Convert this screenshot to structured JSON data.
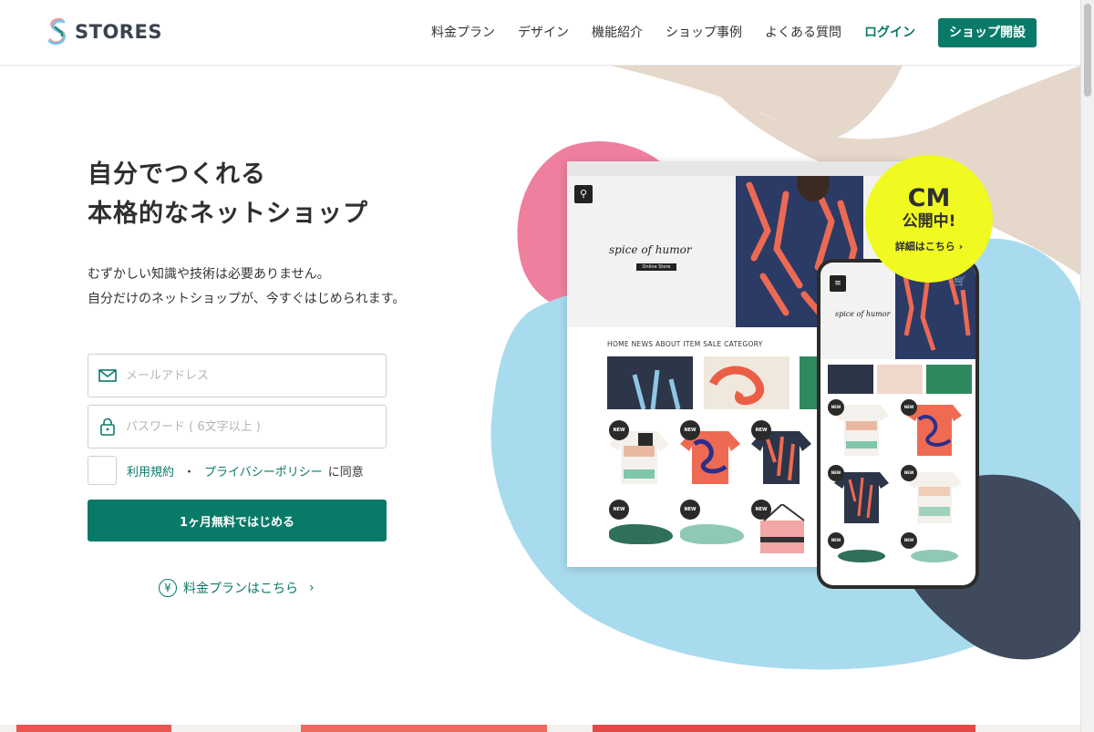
{
  "brand": {
    "name": "STORES"
  },
  "nav": {
    "items": [
      {
        "label": "料金プラン"
      },
      {
        "label": "デザイン"
      },
      {
        "label": "機能紹介"
      },
      {
        "label": "ショップ事例"
      },
      {
        "label": "よくある質問"
      }
    ],
    "login": "ログイン",
    "cta": "ショップ開設"
  },
  "hero": {
    "title_line1": "自分でつくれる",
    "title_line2": "本格的なネットショップ",
    "sub_line1": "むずかしい知識や技術は必要ありません。",
    "sub_line2": "自分だけのネットショップが、今すぐはじめられます。"
  },
  "form": {
    "email_placeholder": "メールアドレス",
    "password_placeholder": "パスワード ( 6文字以上 )",
    "terms_link": "利用規約",
    "separator": "・",
    "privacy_link": "プライバシーポリシー",
    "agree_suffix": "に同意",
    "submit": "1ヶ月無料ではじめる",
    "plan_link": "料金プランはこちら",
    "plan_icon_glyph": "¥",
    "plan_chevron": "›"
  },
  "mockup": {
    "brand_script": "spice of humor",
    "brand_tag": "Online Store",
    "menu": "HOME   NEWS   ABOUT   ITEM   SALE   CATEGORY",
    "badge": "NEW"
  },
  "cm_badge": {
    "line1": "CM",
    "line2": "公開中!",
    "line3": "詳細はこちら ›"
  },
  "colors": {
    "accent": "#0a7a68",
    "cm_yellow": "#f0fa20",
    "blob_blue": "#a8dbee",
    "blob_pink": "#ef7f9f",
    "blob_navy": "#3f4b5c",
    "blob_beige": "#e6d7cb"
  },
  "icons": {
    "email": "mail-icon",
    "password": "lock-icon",
    "plan": "yen-icon",
    "search": "search-icon"
  }
}
